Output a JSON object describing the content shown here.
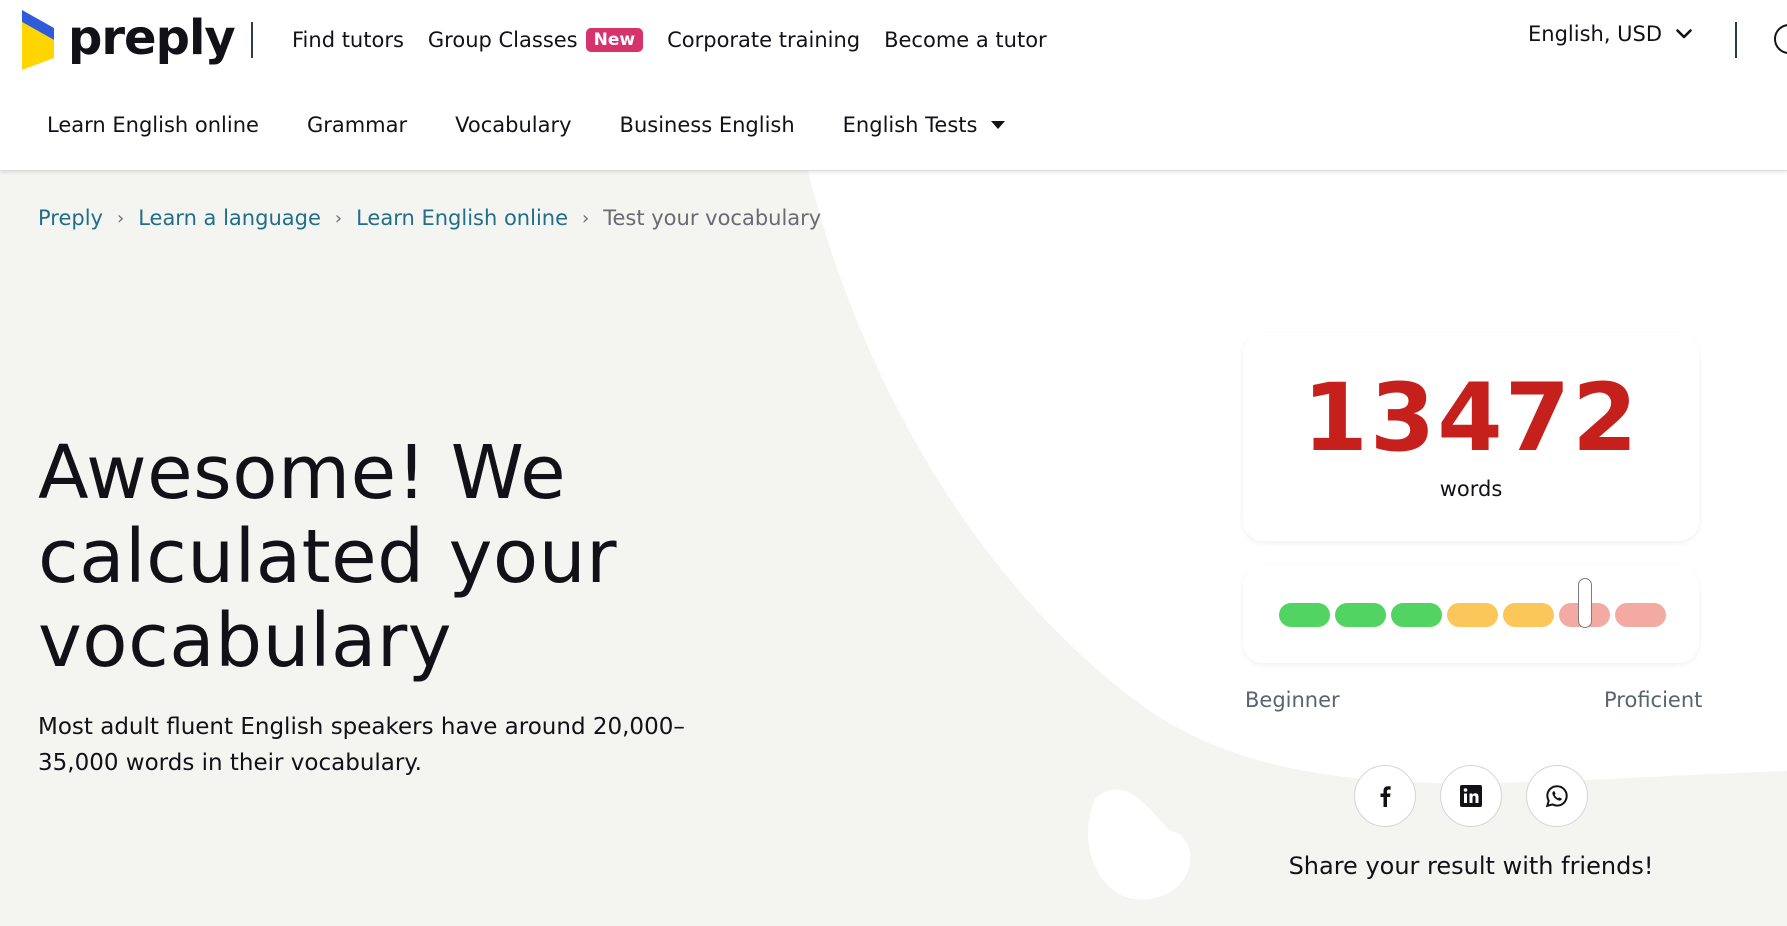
{
  "header": {
    "logo_text": "preply",
    "nav": [
      {
        "label": "Find tutors"
      },
      {
        "label": "Group Classes",
        "badge": "New"
      },
      {
        "label": "Corporate training"
      },
      {
        "label": "Become a tutor"
      }
    ],
    "language_currency": "English, USD",
    "icons": {
      "language_chevron": "chevron-down-icon",
      "search": "search-icon"
    }
  },
  "subnav": {
    "items": [
      {
        "label": "Learn English online"
      },
      {
        "label": "Grammar"
      },
      {
        "label": "Vocabulary"
      },
      {
        "label": "Business English"
      },
      {
        "label": "English Tests",
        "has_dropdown": true
      }
    ]
  },
  "breadcrumb": {
    "items": [
      "Preply",
      "Learn a language",
      "Learn English online"
    ],
    "current": "Test your vocabulary",
    "separator": "›"
  },
  "hero": {
    "headline_lines": [
      "Awesome! We",
      "calculated your",
      "vocabulary"
    ],
    "description": "Most adult fluent English speakers have around 20,000–35,000 words in their vocabulary."
  },
  "result": {
    "word_count": "13472",
    "word_label": "words",
    "scale": {
      "segment_colors": [
        "#52d462",
        "#52d462",
        "#52d462",
        "#fbc65a",
        "#fbc65a",
        "#f2aaa3",
        "#f2aaa3"
      ],
      "marker_position_fraction": 0.79,
      "low_label": "Beginner",
      "high_label": "Proficient"
    },
    "share": {
      "buttons": [
        "facebook-icon",
        "linkedin-icon",
        "whatsapp-icon"
      ],
      "text": "Share your result with friends!"
    }
  },
  "colors": {
    "accent_red": "#c6201c",
    "badge_pink": "#d6336c",
    "link_teal": "#1f6f8b",
    "hero_bg": "#f4f4f1",
    "logo_blue": "#2f5bd8",
    "logo_yellow": "#ffd500"
  }
}
